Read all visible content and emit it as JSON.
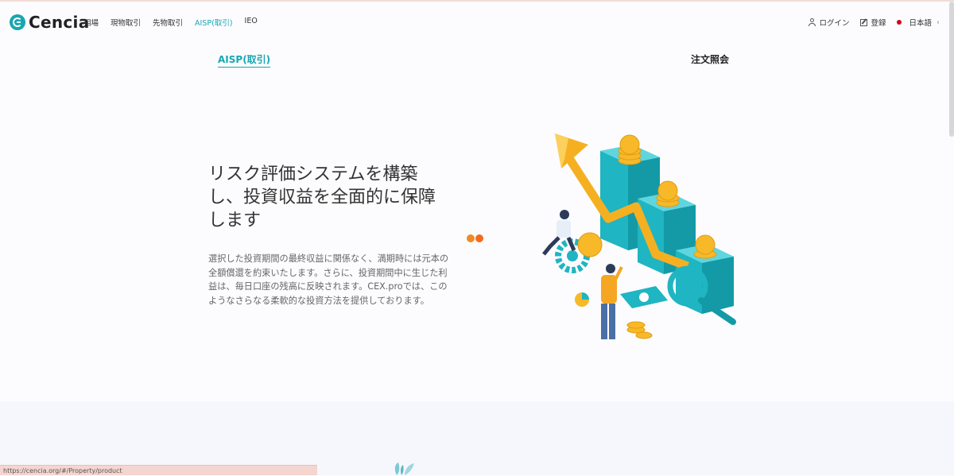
{
  "brand": {
    "name": "Cencia",
    "accent": "#1aa7b3"
  },
  "nav": {
    "items": [
      {
        "label": "相場",
        "active": false
      },
      {
        "label": "現物取引",
        "active": false
      },
      {
        "label": "先物取引",
        "active": false
      },
      {
        "label": "AISP(取引)",
        "active": true
      },
      {
        "label": "IEO",
        "active": false
      }
    ]
  },
  "header_right": {
    "login": "ログイン",
    "register": "登録",
    "language": "日本語",
    "chevron": "‹"
  },
  "tabs": {
    "aisp": "AISP(取引)",
    "orders": "注文照会"
  },
  "hero": {
    "title": "リスク評価システムを構築し、投資収益を全面的に保障します",
    "description": "選択した投資期間の最終収益に関係なく、満期時には元本の全額償還を約束いたします。さらに、投資期間中に生じた利益は、毎日口座の残高に反映されます。CEX.proでは、このようなさらなる柔軟的な投資方法を提供しております。"
  },
  "status_bar": {
    "url": "https://cencia.org/#/Property/product"
  }
}
